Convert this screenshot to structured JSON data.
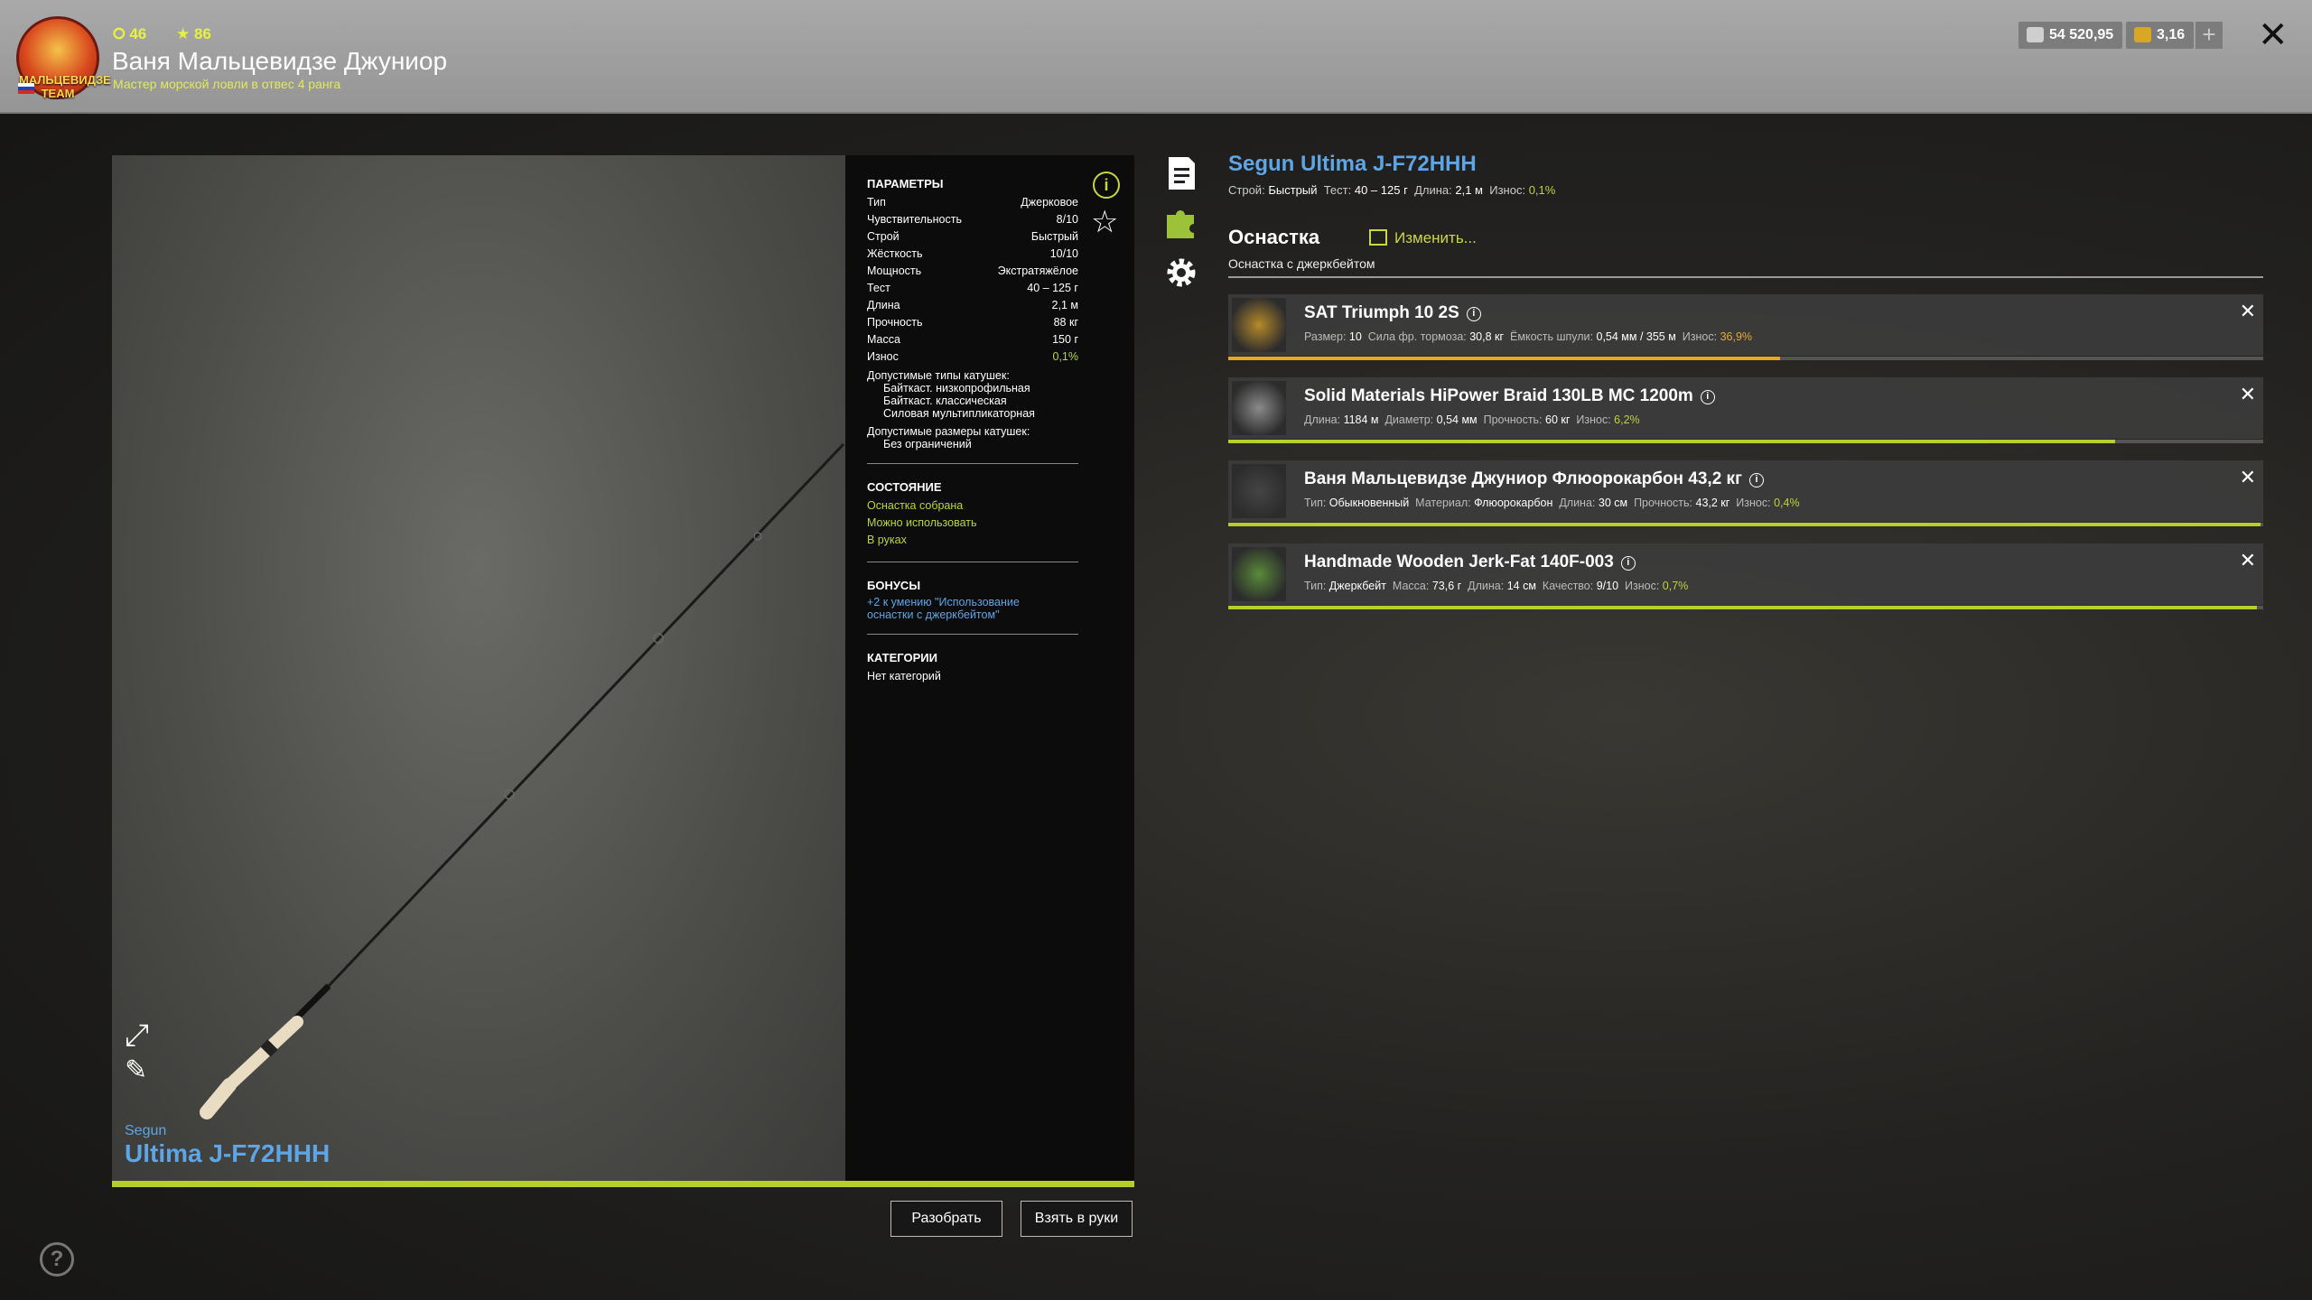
{
  "player": {
    "level": "46",
    "stars": "86",
    "name": "Ваня Мальцевидзе Джуниор",
    "title": "Мастер морской ловли в отвес 4 ранга",
    "avatar_text": "MAЛЬЦЕВИДЗЕ TEAM"
  },
  "currency": {
    "silver": "54 520,95",
    "gold": "3,16",
    "add_label": "+"
  },
  "viewer": {
    "brand": "Segun",
    "model": "Ultima J-F72HHH"
  },
  "params": {
    "header": "ПАРАМЕТРЫ",
    "rows": [
      {
        "label": "Тип",
        "value": "Джерковое"
      },
      {
        "label": "Чувствительность",
        "value": "8/10"
      },
      {
        "label": "Строй",
        "value": "Быстрый"
      },
      {
        "label": "Жёсткость",
        "value": "10/10"
      },
      {
        "label": "Мощность",
        "value": "Экстратяжёлое"
      },
      {
        "label": "Тест",
        "value": "40 – 125 г"
      },
      {
        "label": "Длина",
        "value": "2,1 м"
      },
      {
        "label": "Прочность",
        "value": "88 кг"
      },
      {
        "label": "Масса",
        "value": "150 г"
      },
      {
        "label": "Износ",
        "value": "0,1%"
      }
    ],
    "reel_types_label": "Допустимые типы катушек:",
    "reel_types": [
      "Байткаст. низкопрофильная",
      "Байткаст. классическая",
      "Силовая мультипликаторная"
    ],
    "reel_sizes_label": "Допустимые размеры катушек:",
    "reel_sizes": "Без ограничений"
  },
  "state": {
    "header": "СОСТОЯНИЕ",
    "items": [
      "Оснастка собрана",
      "Можно использовать",
      "В руках"
    ]
  },
  "bonuses": {
    "header": "БОНУСЫ",
    "line1": "+2 к умению \"Использование",
    "line2": "оснастки с джеркбейтом\""
  },
  "categories": {
    "header": "КАТЕГОРИИ",
    "value": "Нет категорий"
  },
  "rod": {
    "title": "Segun Ultima J-F72HHH",
    "specs": {
      "build_label": "Строй:",
      "build": "Быстрый",
      "test_label": "Тест:",
      "test": "40 – 125 г",
      "length_label": "Длина:",
      "length": "2,1 м",
      "wear_label": "Износ:",
      "wear": "0,1%"
    }
  },
  "rig": {
    "header": "Оснастка",
    "edit_label": "Изменить...",
    "subtitle": "Оснастка с джеркбейтом"
  },
  "items": [
    {
      "name": "SAT Triumph 10 2S",
      "specs": [
        {
          "label": "Размер:",
          "value": "10"
        },
        {
          "label": "Сила фр. тормоза:",
          "value": "30,8 кг"
        },
        {
          "label": "Ёмкость шпули:",
          "value": "0,54 мм / 355 м"
        },
        {
          "label": "Износ:",
          "value": "36,9%",
          "accent": "o"
        }
      ],
      "condition": 0.533,
      "bar_color": "#e8a623"
    },
    {
      "name": "Solid Materials HiPower Braid 130LB MC 1200m",
      "specs": [
        {
          "label": "Длина:",
          "value": "1184 м"
        },
        {
          "label": "Диаметр:",
          "value": "0,54 мм"
        },
        {
          "label": "Прочность:",
          "value": "60 кг"
        },
        {
          "label": "Износ:",
          "value": "6,2%",
          "accent": "g"
        }
      ],
      "condition": 0.857,
      "bar_color": "#b7cf2a"
    },
    {
      "name": "Ваня Мальцевидзе Джуниор Флюорокарбон 43,2 кг",
      "specs": [
        {
          "label": "Тип:",
          "value": "Обыкновенный"
        },
        {
          "label": "Материал:",
          "value": "Флюорокарбон"
        },
        {
          "label": "Длина:",
          "value": "30 см"
        },
        {
          "label": "Прочность:",
          "value": "43,2 кг"
        },
        {
          "label": "Износ:",
          "value": "0,4%",
          "accent": "g"
        }
      ],
      "condition": 0.997,
      "bar_color": "#b7cf2a"
    },
    {
      "name": "Handmade Wooden Jerk-Fat 140F-003",
      "specs": [
        {
          "label": "Тип:",
          "value": "Джеркбейт"
        },
        {
          "label": "Масса:",
          "value": "73,6 г"
        },
        {
          "label": "Длина:",
          "value": "14 см"
        },
        {
          "label": "Качество:",
          "value": "9/10"
        },
        {
          "label": "Износ:",
          "value": "0,7%",
          "accent": "g"
        }
      ],
      "condition": 0.994,
      "bar_color": "#b7cf2a"
    }
  ],
  "buttons": {
    "disassemble": "Разобрать",
    "take": "Взять в руки"
  },
  "icons": {
    "close": "close-icon",
    "info": "info-icon",
    "star": "star-icon",
    "expand": "expand-icon",
    "edit": "brush-icon",
    "help": "help-icon",
    "description": "document-icon",
    "rig": "puzzle-icon",
    "settings": "gear-icon"
  },
  "colors": {
    "accent_green": "#b7cf2a",
    "title_blue": "#5ea5e6"
  }
}
